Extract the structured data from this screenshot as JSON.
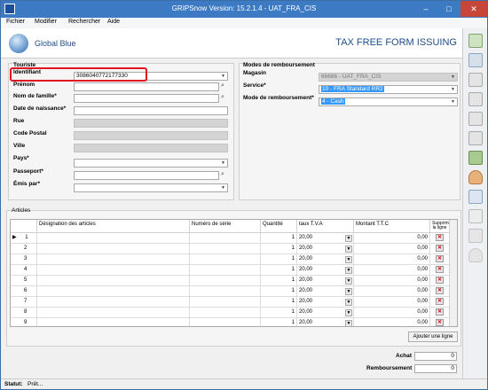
{
  "window": {
    "title": "GRIPSnow Version: 15.2.1.4 - UAT_FRA_CIS"
  },
  "menu": [
    "Fichier",
    "Modifier",
    "Rechercher",
    "Aide"
  ],
  "header": {
    "logo_text": "Global Blue",
    "title": "TAX FREE FORM ISSUING"
  },
  "tourist": {
    "section_label": "Touriste",
    "identifiant_label": "Identifiant",
    "identifiant_value": "3086040772177330",
    "prenom_label": "Prénom",
    "nom_label": "Nom de famille*",
    "naissance_label": "Date de naissance*",
    "rue_label": "Rue",
    "cp_label": "Code Postal",
    "ville_label": "Ville",
    "pays_label": "Pays*",
    "passeport_label": "Passeport*",
    "emis_label": "Émis par*"
  },
  "refund": {
    "section_label": "Modes de remboursement",
    "magasin_label": "Magasin",
    "magasin_value": "66666 - UAT_FRA_CIS",
    "service_label": "Service*",
    "service_value": "10 - FRA Standard RR2",
    "mode_label": "Mode de remboursement*",
    "mode_value": "4 - Cash"
  },
  "articles": {
    "section_label": "Articles",
    "headers": {
      "designation": "Désignation des articles",
      "serie": "Numéro de série",
      "quantite": "Quantité",
      "tva": "taux T.V.A",
      "montant": "Montant T.T.C",
      "supprimer": "Supprimer la ligne"
    },
    "rows": [
      {
        "num": "1",
        "qty": "1",
        "tva": "20,00",
        "montant": "0,00"
      },
      {
        "num": "2",
        "qty": "1",
        "tva": "20,00",
        "montant": "0,00"
      },
      {
        "num": "3",
        "qty": "1",
        "tva": "20,00",
        "montant": "0,00"
      },
      {
        "num": "4",
        "qty": "1",
        "tva": "20,00",
        "montant": "0,00"
      },
      {
        "num": "5",
        "qty": "1",
        "tva": "20,00",
        "montant": "0,00"
      },
      {
        "num": "6",
        "qty": "1",
        "tva": "20,00",
        "montant": "0,00"
      },
      {
        "num": "7",
        "qty": "1",
        "tva": "20,00",
        "montant": "0,00"
      },
      {
        "num": "8",
        "qty": "1",
        "tva": "20,00",
        "montant": "0,00"
      },
      {
        "num": "9",
        "qty": "1",
        "tva": "20,00",
        "montant": "0,00"
      }
    ],
    "add_line_label": "Ajouter une ligne"
  },
  "totals": {
    "achat_label": "Achat",
    "achat_value": "0",
    "remboursement_label": "Remboursement",
    "remboursement_value": "0"
  },
  "status": {
    "label": "Statut:",
    "value": "Prêt..."
  }
}
